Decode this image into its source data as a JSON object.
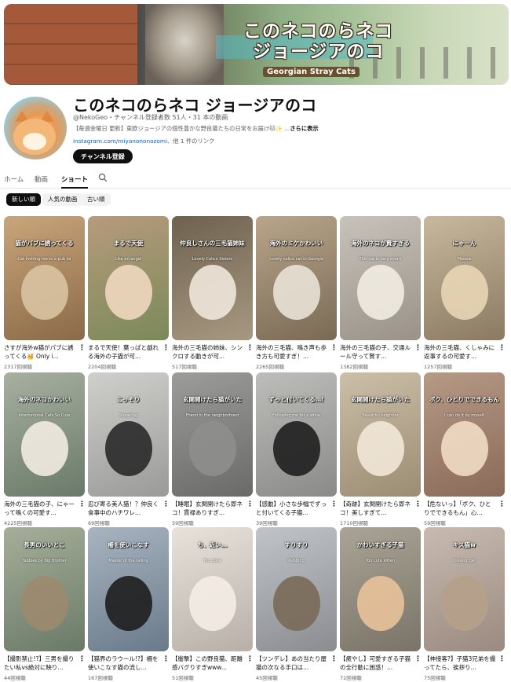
{
  "banner": {
    "title_line1": "このネコのらネコ",
    "title_line2": "ジョージアのコ",
    "subtitle": "Georgian Stray Cats"
  },
  "channel": {
    "name": "このネコのらネコ ジョージアのコ",
    "handle_meta": "@NekoGeo・チャンネル登録者数 51人・31 本の動画",
    "description": "【毎週金曜日 更新】東欧ジョージアの個性豊かな野良猫たちの日常をお届け🐱✨ ...",
    "more_label": "さらに表示",
    "link_url": "instagram.com/miyanononozomi",
    "link_more": "、他 1 件のリンク",
    "subscribe_label": "チャンネル登録"
  },
  "tabs": [
    {
      "label": "ホーム"
    },
    {
      "label": "動画"
    },
    {
      "label": "ショート"
    }
  ],
  "filters": [
    {
      "label": "新しい順"
    },
    {
      "label": "人気の動画"
    },
    {
      "label": "古い順"
    }
  ],
  "shorts": [
    {
      "title": "さすが海外w猫がパブに誘ってくる🥳 Only i...",
      "views": "2317回視聴",
      "overlay": "猫がパブに誘ってくる",
      "caption": "Cat inviting me to a pub lol",
      "bg": "#8a6a48",
      "bg2": "#c9a57a",
      "cat": "#d9c3a2"
    },
    {
      "title": "まるで天使！葉っぱと戯れる海外の子猫が可...",
      "views": "2204回視聴",
      "overlay": "まるで天使",
      "caption": "Like an angel",
      "bg": "#7a8a5a",
      "bg2": "#b79a7c",
      "cat": "#f0d8bf"
    },
    {
      "title": "海外の三毛猫の姉妹、シンクロする動きが可...",
      "views": "517回視聴",
      "overlay": "仲良しさんの三毛猫姉妹",
      "caption": "Lovely Calico Sisters",
      "bg": "#a89880",
      "bg2": "#6e6250",
      "cat": "#efe6da"
    },
    {
      "title": "海外の三毛猫、鳴き声も歩き方も可愛すぎ！...",
      "views": "2265回視聴",
      "overlay": "海外のミケかわいい",
      "caption": "Lovely calico cat in Georgia",
      "bg": "#7a6a55",
      "bg2": "#b8a58a",
      "cat": "#e9e2d6"
    },
    {
      "title": "海外の三毛猫の子、交通ルール守って賢す...",
      "views": "1382回視聴",
      "overlay": "海外のネコが賢すぎる",
      "caption": "This cat is very smart",
      "bg": "#9a9288",
      "bg2": "#c7c2ba",
      "cat": "#f2ece2"
    },
    {
      "title": "海外の三毛猫、くしゃみに返事するの可愛す...",
      "views": "1257回視聴",
      "overlay": "にゃーん",
      "caption": "Meoow",
      "bg": "#8a7a62",
      "bg2": "#c8b89c",
      "cat": "#e8d6b6"
    },
    {
      "title": "海外の三毛猫の子、にゃーって鳴くの可愛す...",
      "views": "4225回視聴",
      "overlay": "海外のネコかわいい",
      "caption": "International Cats So Cute",
      "bg": "#6a7a6a",
      "bg2": "#a8b0a0",
      "cat": "#f1ebe1"
    },
    {
      "title": "忍び寄る美人猫！？仲良く食事中のハチワレ...",
      "views": "69回視聴",
      "overlay": "こっそり",
      "caption": "Sneaking",
      "bg": "#9a9a98",
      "bg2": "#cfcfcc",
      "cat": "#2a2a2a"
    },
    {
      "title": "【睡眠】玄関開けたら即ネコ！貫禄ありすぎ...",
      "views": "59回視聴",
      "overlay": "玄関開けたら猫がいた",
      "caption": "Friend in the neighborhood",
      "bg": "#6a6a68",
      "bg2": "#9c9c9a",
      "cat": "#8e8e8c"
    },
    {
      "title": "【感動】小さな歩幅でずっと付いてくる子猫...",
      "views": "39回視聴",
      "overlay": "ずっと付いてくる…!",
      "caption": "Following me for a while",
      "bg": "#8a8a88",
      "bg2": "#bdbdba",
      "cat": "#1f1f1f"
    },
    {
      "title": "【奇跡】玄関開けたら即ネコ！美しすぎて...",
      "views": "1710回視聴",
      "overlay": "玄関開けたら猫がいた",
      "caption": "Beautiful neighbor",
      "bg": "#9c8c74",
      "bg2": "#cbbfa8",
      "cat": "#f2e8d8"
    },
    {
      "title": "【危ないっ】「ボク、ひとりでできるもん」心...",
      "views": "59回視聴",
      "overlay": "ボク、ひとりでできるもん",
      "caption": "I can do it by myself",
      "bg": "#8a6a58",
      "bg2": "#b59a86",
      "cat": "#f1dcc4"
    },
    {
      "title": "【撮影禁止!?】三男を撮りたい私vs絶対に映り...",
      "views": "44回視聴",
      "overlay": "長男のいいとこ",
      "caption": "Tabbies by Big Brother",
      "bg": "#6a7a68",
      "bg2": "#a6ae98",
      "cat": "#9c8a6e"
    },
    {
      "title": "【猫界のラウール!?】柵を使いこなす猫の流し...",
      "views": "167回視聴",
      "overlay": "柵を使いこなす",
      "caption": "Master of the railing",
      "bg": "#6a7a8a",
      "bg2": "#a8b4c0",
      "cat": "#1e1e1e"
    },
    {
      "title": "【衝撃】この野良猫、距離感バグりすぎwww...",
      "views": "51回視聴",
      "overlay": "ち、近い…",
      "caption": "Too close",
      "bg": "#b8b0a8",
      "bg2": "#e8e2da",
      "cat": "#f4ece6"
    },
    {
      "title": "【ツンデレ】あの当たり屋猫の次なる手口は...",
      "views": "45回視聴",
      "overlay": "すりすり",
      "caption": "Rubbing",
      "bg": "#8a8c90",
      "bg2": "#c0c4c8",
      "cat": "#7a6a58"
    },
    {
      "title": "【癒やし】可愛すぎる子猫の全行動に困惑！...",
      "views": "72回視聴",
      "overlay": "かわいすぎる子猫",
      "caption": "Too cute kitten",
      "bg": "#7a7468",
      "bg2": "#aaa496",
      "cat": "#e8c29a"
    },
    {
      "title": "【神接客?】子猫3兄弟を撮ってたら、挨拶り...",
      "views": "75回視聴",
      "overlay": "キス猫w",
      "caption": "Kissing cat",
      "bg": "#9a8a80",
      "bg2": "#c8bab0",
      "cat": "#b5a08a"
    }
  ]
}
